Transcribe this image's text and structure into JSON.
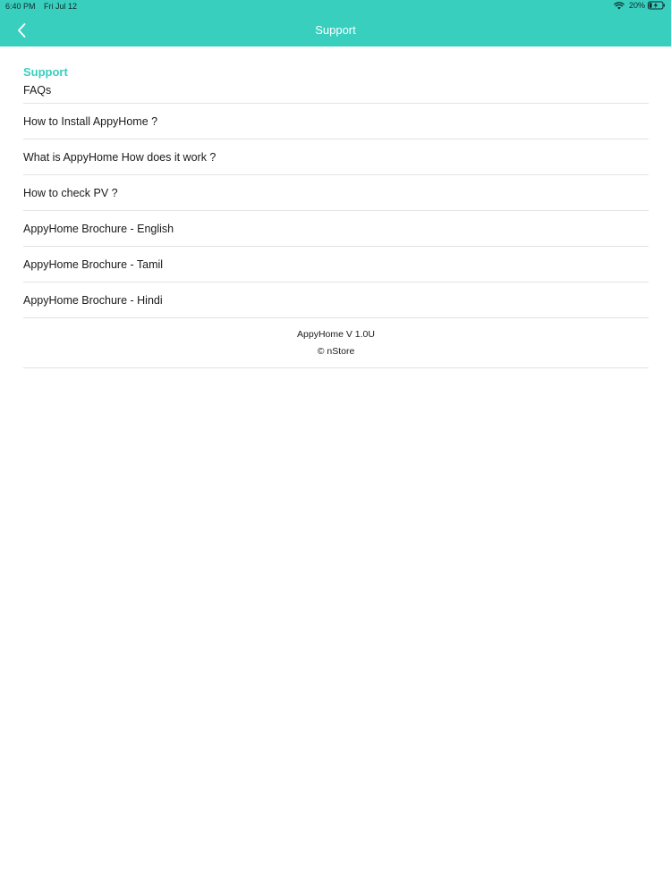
{
  "status_bar": {
    "time": "6:40 PM",
    "date": "Fri Jul 12",
    "battery_percent": "20%",
    "battery_level": 0.2,
    "icons": [
      "wifi-icon",
      "battery-charging-icon"
    ]
  },
  "nav": {
    "title": "Support",
    "back_icon": "chevron-left-icon"
  },
  "colors": {
    "accent": "#38cfbf",
    "divider": "#e3e3e3",
    "text": "#1a1a1a"
  },
  "support": {
    "title": "Support",
    "subtitle": "FAQs",
    "items": [
      "How to Install AppyHome ?",
      "What is AppyHome How does it work ?",
      "How to check PV ?",
      "AppyHome Brochure - English",
      "AppyHome Brochure - Tamil",
      "AppyHome Brochure - Hindi"
    ]
  },
  "footer": {
    "version": "AppyHome V 1.0U",
    "copyright": "© nStore"
  }
}
